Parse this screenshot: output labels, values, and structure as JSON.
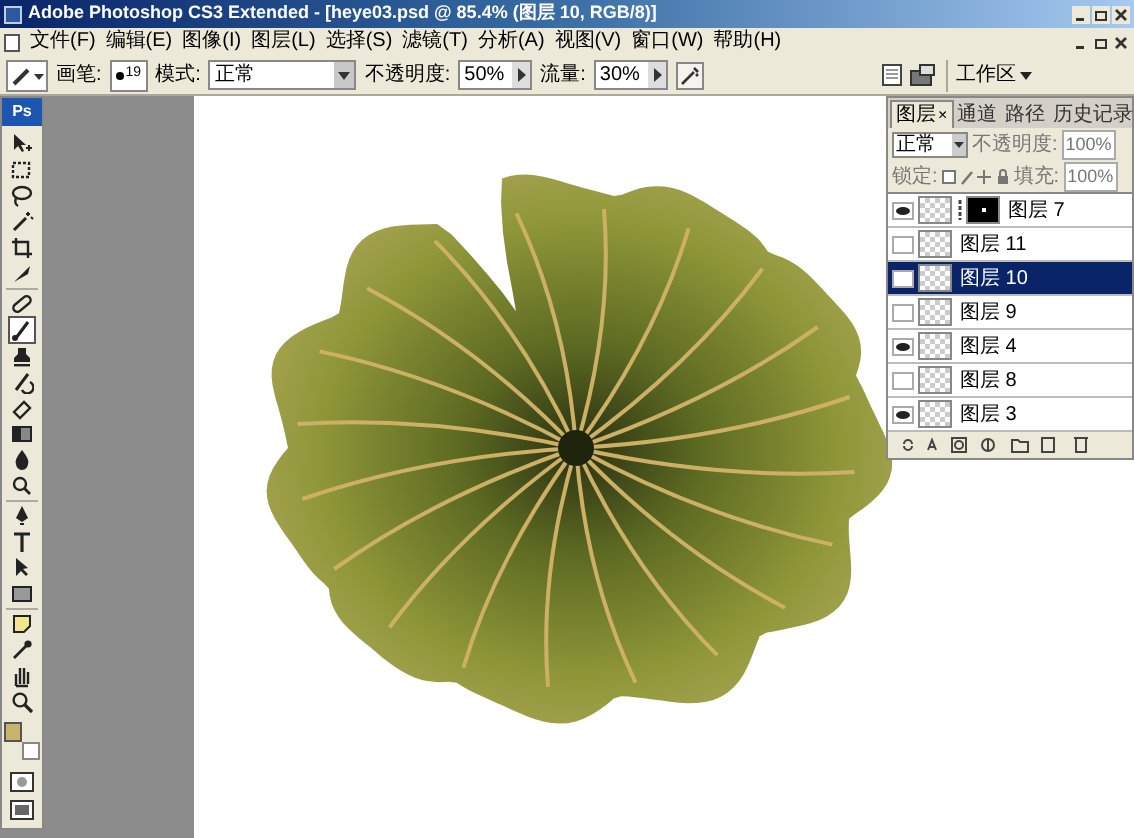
{
  "window": {
    "title": "Adobe Photoshop CS3 Extended - [heye03.psd @ 85.4% (图层 10, RGB/8)]"
  },
  "menu": [
    "文件(F)",
    "编辑(E)",
    "图像(I)",
    "图层(L)",
    "选择(S)",
    "滤镜(T)",
    "分析(A)",
    "视图(V)",
    "窗口(W)",
    "帮助(H)"
  ],
  "options_bar": {
    "brush_label": "画笔:",
    "brush_size": "19",
    "mode_label": "模式:",
    "mode": "正常",
    "opacity_label": "不透明度:",
    "opacity": "50%",
    "flow_label": "流量:",
    "flow": "30%",
    "workspace": "工作区"
  },
  "toolbox": {
    "logo": "Ps",
    "tools": [
      {
        "kind": "move",
        "selected": false
      },
      {
        "kind": "marquee",
        "selected": false
      },
      {
        "kind": "lasso",
        "selected": false
      },
      {
        "kind": "wand",
        "selected": false
      },
      {
        "kind": "crop",
        "selected": false
      },
      {
        "kind": "slice",
        "selected": false
      },
      {
        "kind": "heal",
        "selected": false
      },
      {
        "kind": "brush",
        "selected": true
      },
      {
        "kind": "stamp",
        "selected": false
      },
      {
        "kind": "history",
        "selected": false
      },
      {
        "kind": "eraser",
        "selected": false
      },
      {
        "kind": "gradient",
        "selected": false
      },
      {
        "kind": "blur",
        "selected": false
      },
      {
        "kind": "dodge",
        "selected": false
      },
      {
        "kind": "pen",
        "selected": false
      },
      {
        "kind": "type",
        "selected": false
      },
      {
        "kind": "select",
        "selected": false
      },
      {
        "kind": "shape",
        "selected": false
      },
      {
        "kind": "notes",
        "selected": false
      },
      {
        "kind": "eyedropper",
        "selected": false
      },
      {
        "kind": "hand",
        "selected": false
      },
      {
        "kind": "zoom",
        "selected": false
      }
    ]
  },
  "layers_panel": {
    "tabs": [
      {
        "label": "图层",
        "selected": true
      },
      {
        "label": "通道",
        "selected": false
      },
      {
        "label": "路径",
        "selected": false
      },
      {
        "label": "历史记录",
        "selected": false
      }
    ],
    "close": "×",
    "blend_mode": "正常",
    "opacity_label": "不透明度:",
    "opacity": "100%",
    "lock_label": "锁定:",
    "fill_label": "填充:",
    "fill": "100%",
    "layers": [
      {
        "name": "图层 7",
        "visible": true,
        "selected": false,
        "has_mask": true
      },
      {
        "name": "图层 11",
        "visible": false,
        "selected": false,
        "has_mask": false
      },
      {
        "name": "图层 10",
        "visible": false,
        "selected": true,
        "has_mask": false
      },
      {
        "name": "图层 9",
        "visible": false,
        "selected": false,
        "has_mask": false
      },
      {
        "name": "图层 4",
        "visible": true,
        "selected": false,
        "has_mask": false
      },
      {
        "name": "图层 8",
        "visible": false,
        "selected": false,
        "has_mask": false
      },
      {
        "name": "图层 3",
        "visible": true,
        "selected": false,
        "has_mask": false
      }
    ]
  }
}
